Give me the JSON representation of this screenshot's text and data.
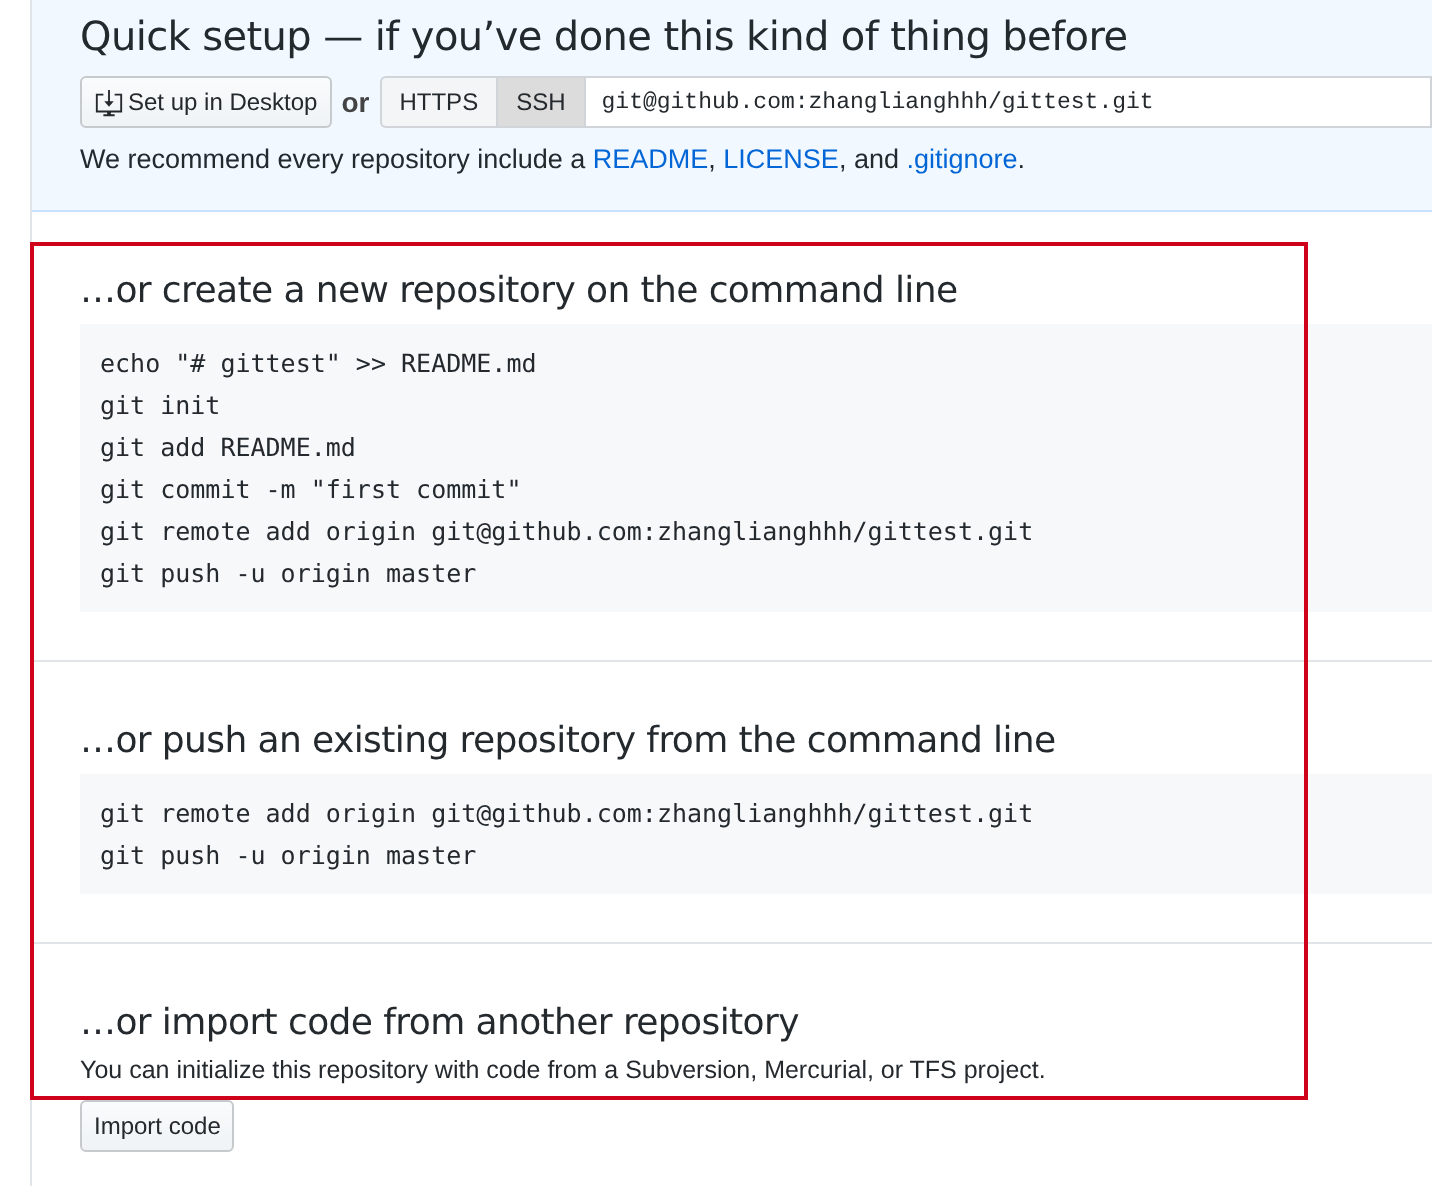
{
  "quick_setup": {
    "title": "Quick setup — if you’ve done this kind of thing before",
    "desktop_button": "Set up in Desktop",
    "or_text": "or",
    "protocols": [
      {
        "label": "HTTPS",
        "selected": false
      },
      {
        "label": "SSH",
        "selected": true
      }
    ],
    "clone_url": "git@github.com:zhanglianghhh/gittest.git",
    "recommendation": [
      {
        "kind": "text",
        "text": "We recommend every repository include a "
      },
      {
        "kind": "link",
        "text": "README"
      },
      {
        "kind": "text",
        "text": ", "
      },
      {
        "kind": "link",
        "text": "LICENSE"
      },
      {
        "kind": "text",
        "text": ", and "
      },
      {
        "kind": "link",
        "text": ".gitignore"
      },
      {
        "kind": "text",
        "text": "."
      }
    ]
  },
  "sections": [
    {
      "heading": "…or create a new repository on the command line",
      "code_lines": [
        "echo \"# gittest\" >> README.md",
        "git init",
        "git add README.md",
        "git commit -m \"first commit\"",
        "git remote add origin git@github.com:zhanglianghhh/gittest.git",
        "git push -u origin master"
      ]
    },
    {
      "heading": "…or push an existing repository from the command line",
      "code_lines": [
        "git remote add origin git@github.com:zhanglianghhh/gittest.git",
        "git push -u origin master"
      ]
    }
  ],
  "import": {
    "heading": "…or import code from another repository",
    "description": "You can initialize this repository with code from a Subversion, Mercurial, or TFS project.",
    "button": "Import code"
  }
}
